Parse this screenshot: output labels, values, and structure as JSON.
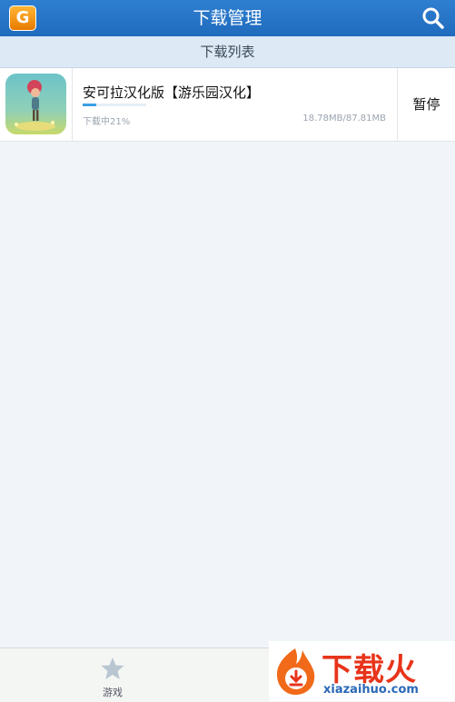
{
  "header": {
    "title": "下载管理",
    "logo_icon": "app-logo-icon",
    "search_icon": "search-icon"
  },
  "subheader": {
    "label": "下载列表"
  },
  "downloads": [
    {
      "name": "安可拉汉化版【游乐园汉化】",
      "status": "下载中21%",
      "progress_fraction": 0.21,
      "size": "18.78MB/87.81MB",
      "action_label": "暂停",
      "thumb_icon": "game-thumbnail-image"
    }
  ],
  "bottom_nav": {
    "tabs": [
      {
        "label": "游戏",
        "icon": "star-icon"
      }
    ]
  },
  "watermark": {
    "logo_text": "下载火",
    "domain": "xiazaihuo.com",
    "icon": "flame-download-icon"
  },
  "colors": {
    "header_bg": "#1f6bbd",
    "subheader_bg": "#dde9f5",
    "progress": "#3aa0e6",
    "watermark_red": "#e8341a",
    "watermark_blue": "#2a68b8"
  }
}
